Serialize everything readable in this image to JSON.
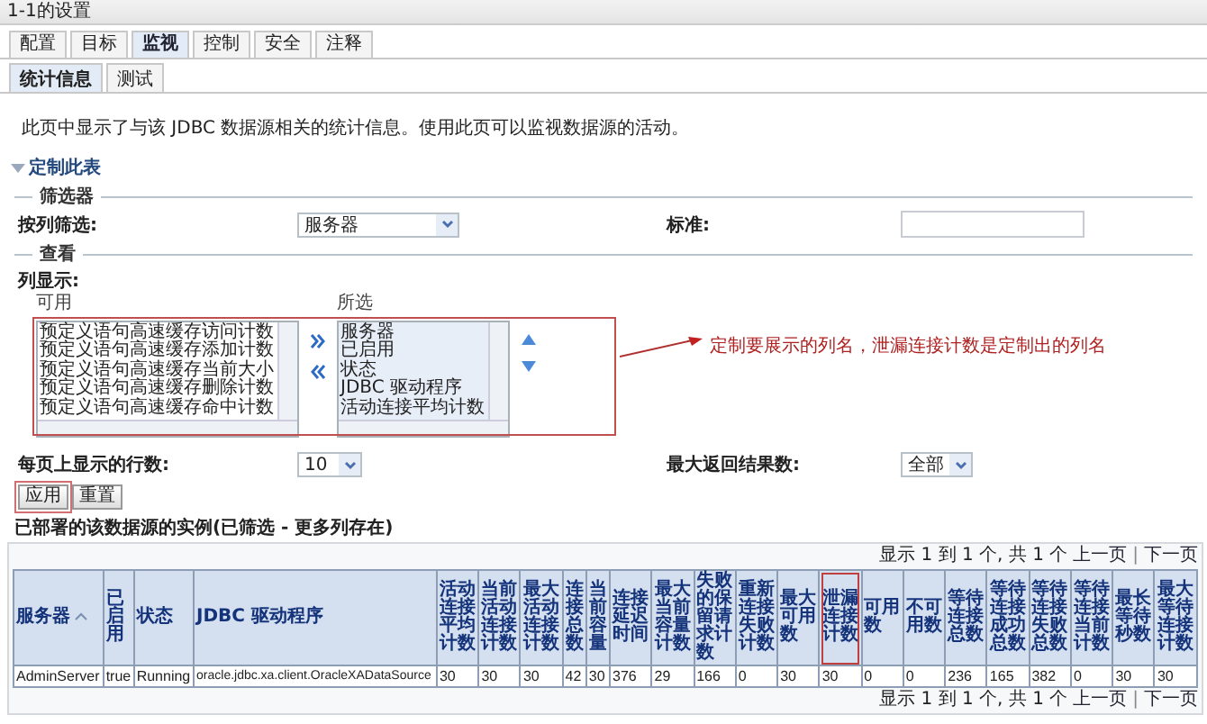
{
  "window": {
    "title": "1-1的设置"
  },
  "tabs": [
    {
      "label": "配置",
      "selected": false
    },
    {
      "label": "目标",
      "selected": false
    },
    {
      "label": "监视",
      "selected": true
    },
    {
      "label": "控制",
      "selected": false
    },
    {
      "label": "安全",
      "selected": false
    },
    {
      "label": "注释",
      "selected": false
    }
  ],
  "subtabs": [
    {
      "label": "统计信息",
      "selected": true
    },
    {
      "label": "测试",
      "selected": false
    }
  ],
  "description": "此页中显示了与该 JDBC 数据源相关的统计信息。使用此页可以监视数据源的活动。",
  "customize": {
    "label": "定制此表",
    "expanded": true
  },
  "filter": {
    "legend": "筛选器",
    "column_label": "按列筛选:",
    "column_value": "服务器",
    "criteria_label": "标准:"
  },
  "view": {
    "legend": "查看",
    "columns_label": "列显示:",
    "available_label": "可用",
    "available": [
      "预定义语句高速缓存访问计数",
      "预定义语句高速缓存添加计数",
      "预定义语句高速缓存当前大小",
      "预定义语句高速缓存删除计数",
      "预定义语句高速缓存命中计数"
    ],
    "selected_label": "所选",
    "selected": [
      "服务器",
      "已启用",
      "状态",
      "JDBC 驱动程序",
      "活动连接平均计数"
    ],
    "rows_label": "每页上显示的行数:",
    "rows_value": "10",
    "max_label": "最大返回结果数:",
    "max_value": "全部"
  },
  "buttons": [
    {
      "label": "应用",
      "highlighted": true
    },
    {
      "label": "重置",
      "highlighted": false
    }
  ],
  "annotation": {
    "text": "定制要展示的列名，泄漏连接计数是定制出的列名"
  },
  "table": {
    "title": "已部署的该数据源的实例(已筛选 - 更多列存在)",
    "pager_top": {
      "summary": "显示 1 到 1 个, 共 1 个",
      "prev": "上一页",
      "separator": "|",
      "next": "下一页"
    },
    "columns": [
      {
        "label": "服务器",
        "sorted": true,
        "highlighted": false
      },
      {
        "label": "已启用",
        "sorted": false,
        "highlighted": false
      },
      {
        "label": "状态",
        "sorted": false,
        "highlighted": false
      },
      {
        "label": "JDBC 驱动程序",
        "sorted": false,
        "highlighted": false
      },
      {
        "label": "活动连接平均计数",
        "sorted": false,
        "highlighted": false
      },
      {
        "label": "当前活动连接计数",
        "sorted": false,
        "highlighted": false
      },
      {
        "label": "最大活动连接计数",
        "sorted": false,
        "highlighted": false
      },
      {
        "label": "连接总数",
        "sorted": false,
        "highlighted": false
      },
      {
        "label": "当前容量",
        "sorted": false,
        "highlighted": false
      },
      {
        "label": "连接延迟时间",
        "sorted": false,
        "highlighted": false
      },
      {
        "label": "最大当前容量计数",
        "sorted": false,
        "highlighted": false
      },
      {
        "label": "失败的保留请求计数",
        "sorted": false,
        "highlighted": false
      },
      {
        "label": "重新连接失败计数",
        "sorted": false,
        "highlighted": false
      },
      {
        "label": "最大可用数",
        "sorted": false,
        "highlighted": false
      },
      {
        "label": "泄漏连接计数",
        "sorted": false,
        "highlighted": true
      },
      {
        "label": "可用数",
        "sorted": false,
        "highlighted": false
      },
      {
        "label": "不可用数",
        "sorted": false,
        "highlighted": false
      },
      {
        "label": "等待连接总数",
        "sorted": false,
        "highlighted": false
      },
      {
        "label": "等待连接成功总数",
        "sorted": false,
        "highlighted": false
      },
      {
        "label": "等待连接失败总数",
        "sorted": false,
        "highlighted": false
      },
      {
        "label": "等待连接当前计数",
        "sorted": false,
        "highlighted": false
      },
      {
        "label": "最长等待秒数",
        "sorted": false,
        "highlighted": false
      },
      {
        "label": "最大等待连接计数",
        "sorted": false,
        "highlighted": false
      }
    ],
    "rows": [
      [
        "AdminServer",
        "true",
        "Running",
        "oracle.jdbc.xa.client.OracleXADataSource",
        "30",
        "30",
        "30",
        "42",
        "30",
        "376",
        "29",
        "166",
        "0",
        "30",
        "30",
        "0",
        "0",
        "236",
        "165",
        "382",
        "0",
        "30",
        "30"
      ]
    ],
    "pager_bottom": {
      "summary": "显示 1 到 1 个, 共 1 个",
      "prev": "上一页",
      "separator": "|",
      "next": "下一页"
    }
  }
}
